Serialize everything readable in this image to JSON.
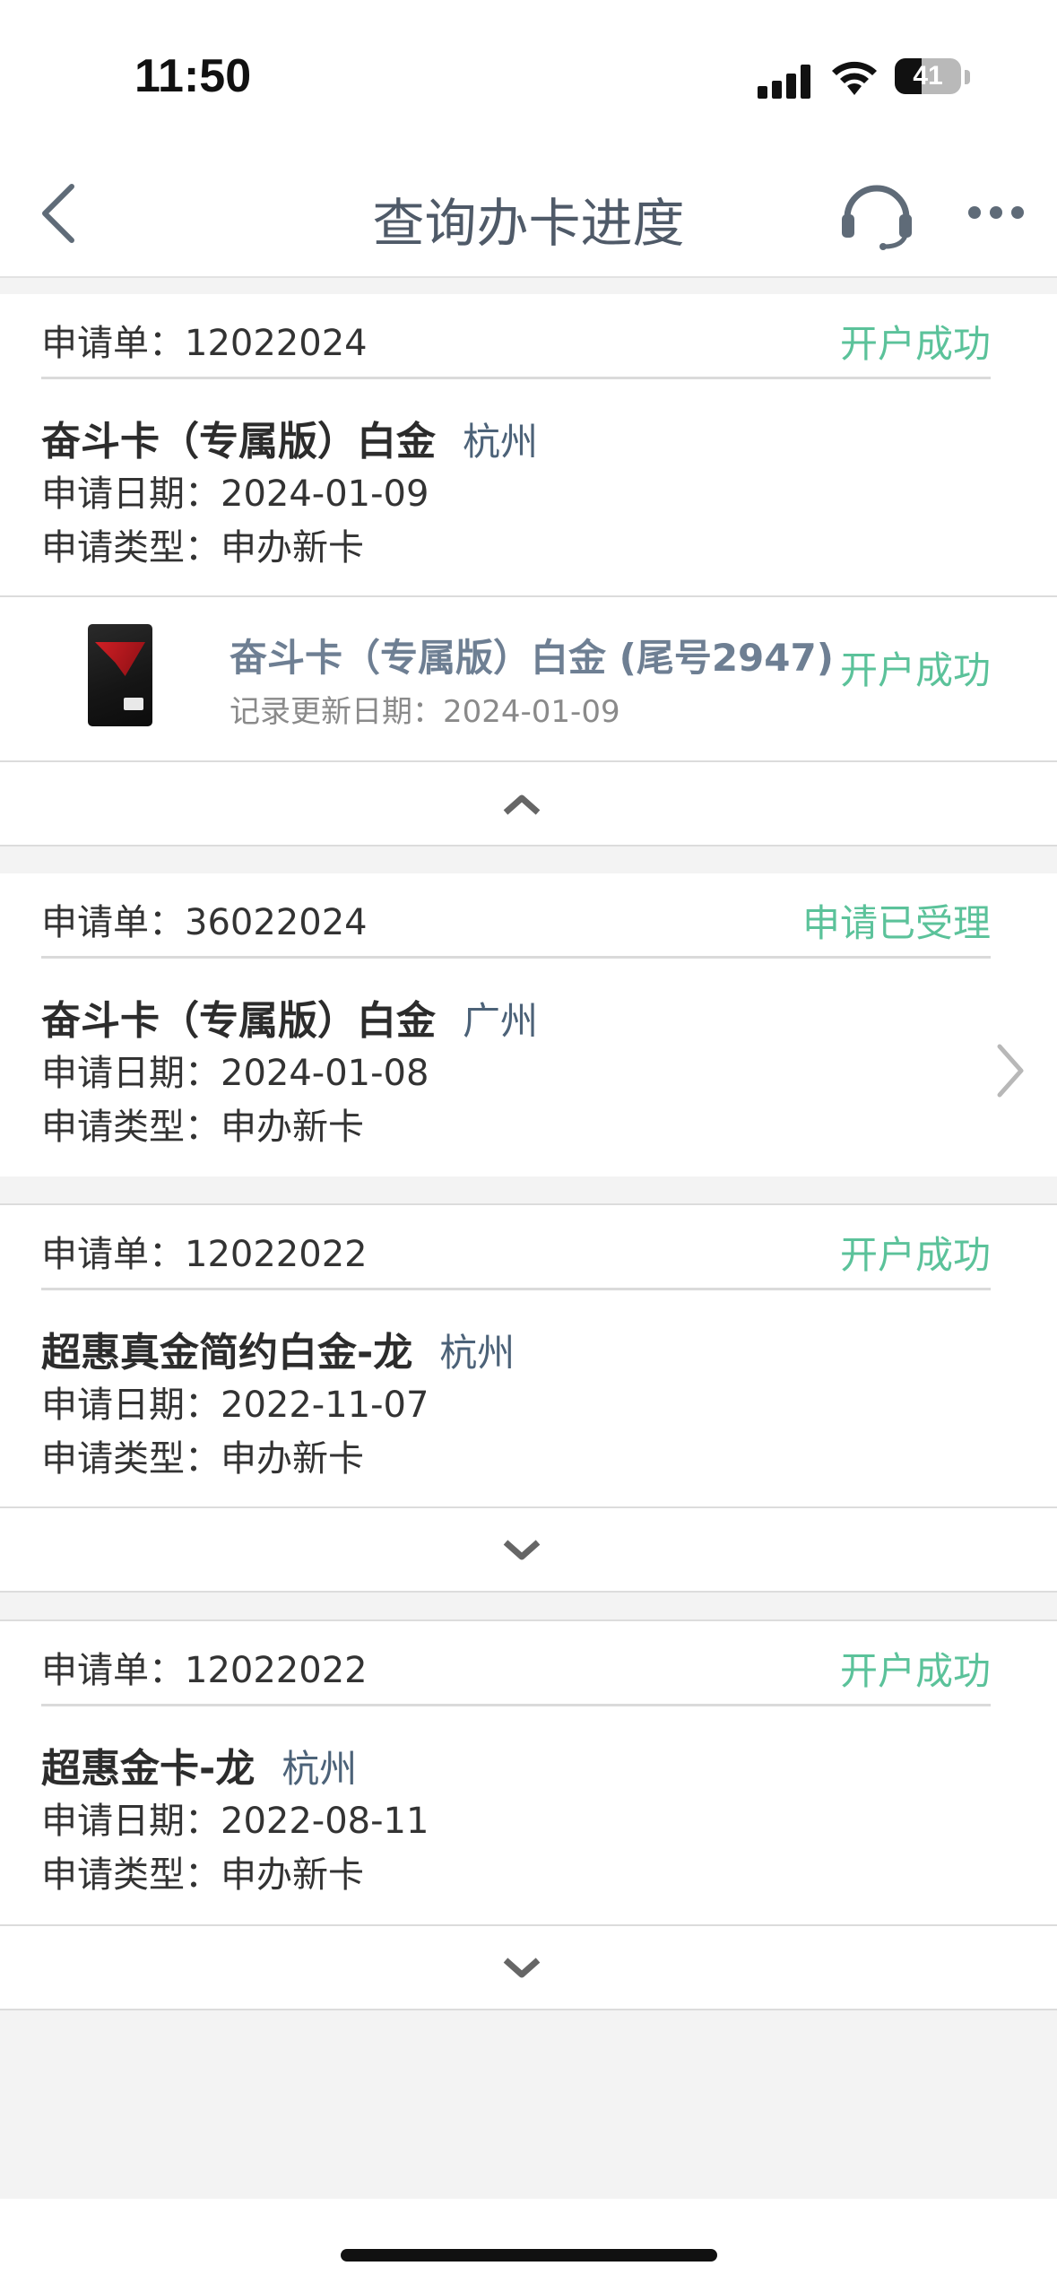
{
  "status_bar": {
    "time": "11:50",
    "battery": "41",
    "battery_level": 0.41
  },
  "nav": {
    "title": "查询办卡进度",
    "back_icon": "chevron-left-icon",
    "service_icon": "headset-icon",
    "more_icon": "more-dots-icon"
  },
  "colors": {
    "success": "#5bc29a",
    "title": "#4f5a68",
    "city": "#4c6278"
  },
  "applications": [
    {
      "order_label": "申请单：",
      "order_no": "12022024",
      "status": "开户成功",
      "product": "奋斗卡（专属版）白金",
      "city": "杭州",
      "date_line": "申请日期：2024-01-09",
      "type_line": "申请类型：申办新卡",
      "card": {
        "title": "奋斗卡（专属版）白金 (尾号2947)",
        "update": "记录更新日期：2024-01-09",
        "status": "开户成功"
      },
      "toggle": "expanded"
    },
    {
      "order_label": "申请单：",
      "order_no": "36022024",
      "status": "申请已受理",
      "product": "奋斗卡（专属版）白金",
      "city": "广州",
      "date_line": "申请日期：2024-01-08",
      "type_line": "申请类型：申办新卡"
    },
    {
      "order_label": "申请单：",
      "order_no": "12022022",
      "status": "开户成功",
      "product": "超惠真金简约白金-龙",
      "city": "杭州",
      "date_line": "申请日期：2022-11-07",
      "type_line": "申请类型：申办新卡",
      "toggle": "collapsed"
    },
    {
      "order_label": "申请单：",
      "order_no": "12022022",
      "status": "开户成功",
      "product": "超惠金卡-龙",
      "city": "杭州",
      "date_line": "申请日期：2022-08-11",
      "type_line": "申请类型：申办新卡",
      "toggle": "collapsed"
    }
  ]
}
